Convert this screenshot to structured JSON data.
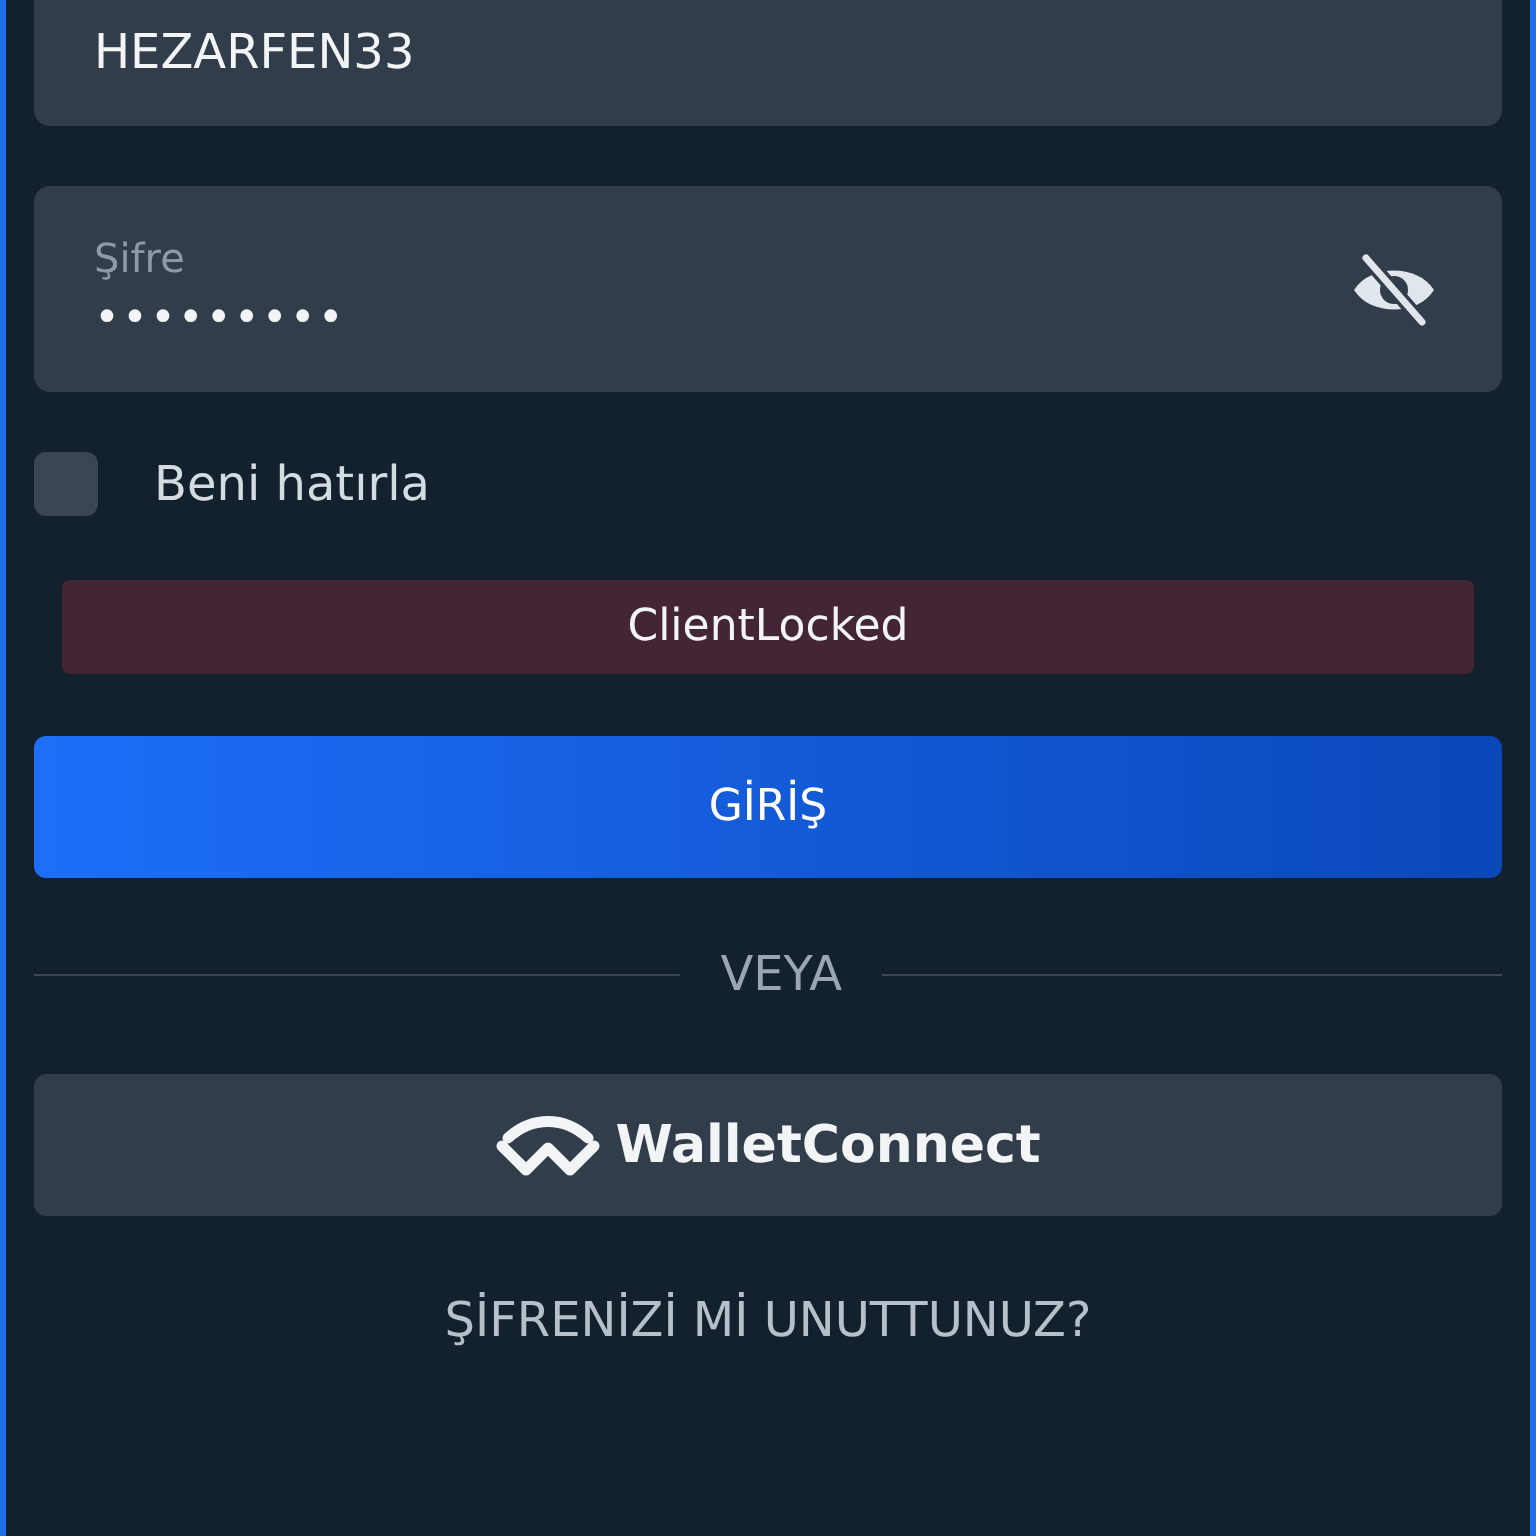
{
  "username_field": {
    "value": "HEZARFEN33"
  },
  "password_field": {
    "label": "Şifre",
    "value": "•••••••••",
    "visible": false
  },
  "remember_me": {
    "label": "Beni hatırla",
    "checked": false
  },
  "error_message": "ClientLocked",
  "login_button": "GİRİŞ",
  "divider_text": "VEYA",
  "wallet_button": "WalletConnect",
  "forgot_password_link": "ŞİFRENİZİ Mİ UNUTTUNUZ?"
}
